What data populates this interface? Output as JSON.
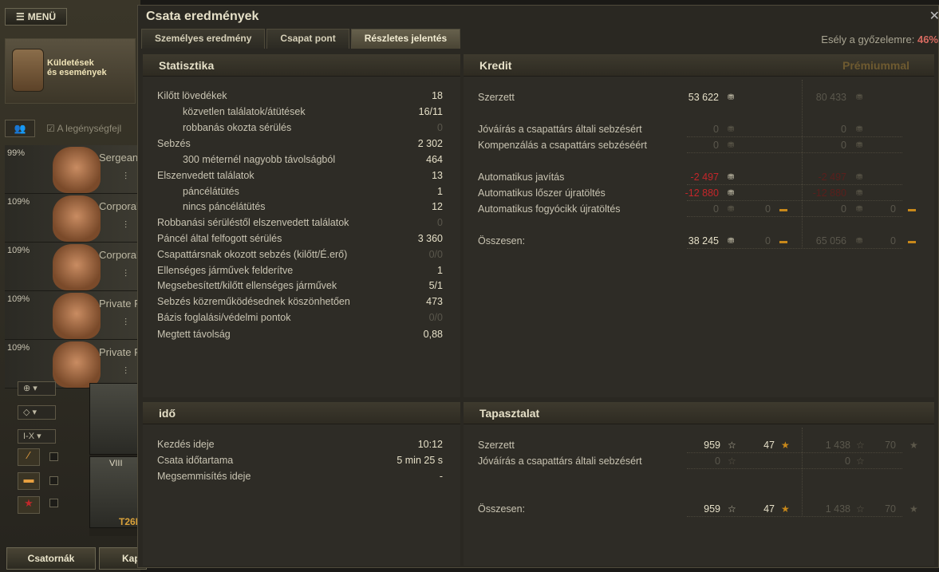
{
  "left": {
    "menu_label": "MENÜ",
    "missions_label_1": "Küldetések",
    "missions_label_2": "és események",
    "crew_filter": "A legénységfejl",
    "crew": [
      {
        "pct": "99%",
        "rank": "Sergean"
      },
      {
        "pct": "109%",
        "rank": "Corporal"
      },
      {
        "pct": "109%",
        "rank": "Corporal"
      },
      {
        "pct": "109%",
        "rank": "Private F"
      },
      {
        "pct": "109%",
        "rank": "Private F"
      }
    ],
    "tank_filter": "I-X",
    "tank_tier": "VIII",
    "tank_name": "T26E",
    "channels_label": "Csatornák",
    "next_label": "Kap"
  },
  "dialog": {
    "title": "Csata eredmények",
    "tabs": [
      "Személyes eredmény",
      "Csapat pont",
      "Részletes jelentés"
    ],
    "active_tab": 2,
    "win_chance_label": "Esély a győzelemre:",
    "win_chance_value": "46%"
  },
  "stats": {
    "header": "Statisztika",
    "rows": [
      {
        "label": "Kilőtt lövedékek",
        "value": "18"
      },
      {
        "label": "közvetlen találatok/átütések",
        "value": "16/11"
      },
      {
        "label": "robbanás okozta sérülés",
        "value": "0"
      },
      {
        "label": "Sebzés",
        "value": "2 302"
      },
      {
        "label": "300 méternél nagyobb távolságból",
        "value": "464"
      },
      {
        "label": "Elszenvedett találatok",
        "value": "13"
      },
      {
        "label": "páncélátütés",
        "value": "1"
      },
      {
        "label": "nincs páncélátütés",
        "value": "12"
      },
      {
        "label": "Robbanási sérüléstől elszenvedett találatok",
        "value": "0"
      },
      {
        "label": "Páncél által felfogott sérülés",
        "value": "3 360"
      },
      {
        "label": "Csapattársnak okozott sebzés (kilőtt/É.erő)",
        "value": "0/0"
      },
      {
        "label": "Ellenséges járművek felderítve",
        "value": "1"
      },
      {
        "label": "Megsebesített/kilőtt ellenséges járművek",
        "value": "5/1"
      },
      {
        "label": "Sebzés közreműködésednek köszönhetően",
        "value": "473"
      },
      {
        "label": "Bázis foglalási/védelmi pontok",
        "value": "0/0"
      },
      {
        "label": "Megtett távolság",
        "value": "0,88"
      }
    ]
  },
  "credit": {
    "header": "Kredit",
    "premium_header": "Prémiummal",
    "rows": [
      {
        "label": "Szerzett",
        "v1": "53 622",
        "v2": "",
        "p1": "80 433",
        "p2": ""
      },
      {
        "label": "Jóváírás a csapattárs általi sebzésért",
        "v1": "0",
        "v2": "",
        "p1": "0",
        "p2": ""
      },
      {
        "label": "Kompenzálás a csapattárs sebzéséért",
        "v1": "0",
        "v2": "",
        "p1": "0",
        "p2": ""
      },
      {
        "label": "Automatikus javítás",
        "v1": "-2 497",
        "v2": "",
        "p1": "-2 497",
        "p2": ""
      },
      {
        "label": "Automatikus lőszer újratöltés",
        "v1": "-12 880",
        "v2": "",
        "p1": "-12 880",
        "p2": ""
      },
      {
        "label": "Automatikus fogyócikk újratöltés",
        "v1": "0",
        "v2": "0",
        "p1": "0",
        "p2": "0"
      },
      {
        "label": "Összesen:",
        "v1": "38 245",
        "v2": "0",
        "p1": "65 056",
        "p2": "0"
      }
    ]
  },
  "time": {
    "header": "idő",
    "rows": [
      {
        "label": "Kezdés ideje",
        "value": "10:12"
      },
      {
        "label": "Csata időtartama",
        "value": "5 min 25 s"
      },
      {
        "label": "Megsemmisítés ideje",
        "value": "-"
      }
    ]
  },
  "xp": {
    "header": "Tapasztalat",
    "rows": [
      {
        "label": "Szerzett",
        "v1": "959",
        "v2": "47",
        "p1": "1 438",
        "p2": "70"
      },
      {
        "label": "Jóváírás a csapattárs általi sebzésért",
        "v1": "0",
        "v2": "",
        "p1": "0",
        "p2": ""
      },
      {
        "label": "Összesen:",
        "v1": "959",
        "v2": "47",
        "p1": "1 438",
        "p2": "70"
      }
    ]
  }
}
